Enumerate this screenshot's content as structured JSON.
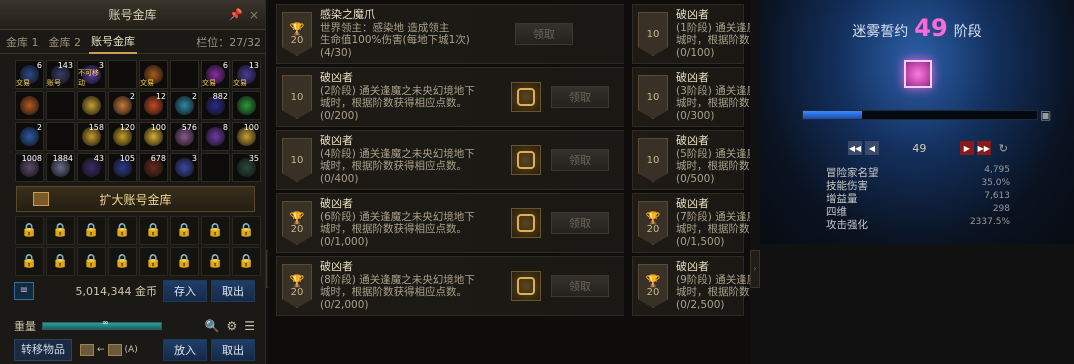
{
  "storage": {
    "title": "账号金库",
    "tabs": [
      "金库 1",
      "金库 2",
      "账号金库"
    ],
    "active_tab": 2,
    "slots_label": "栏位：27/32",
    "items": [
      {
        "color": "#2a4a8a",
        "count": "6",
        "label": "交易"
      },
      {
        "color": "#3a3a6a",
        "count": "143",
        "label": "账号"
      },
      {
        "color": "#5a3aa8",
        "count": "3",
        "label": "不可移动"
      },
      {
        "color": "",
        "count": "",
        "label": ""
      },
      {
        "color": "#a85a1a",
        "count": "",
        "label": "交易"
      },
      {
        "color": "",
        "count": "",
        "label": ""
      },
      {
        "color": "#8a2aa8",
        "count": "6",
        "label": "交易"
      },
      {
        "color": "#4a3a9a",
        "count": "13",
        "label": "交易"
      },
      {
        "color": "#b85a20",
        "count": "",
        "label": ""
      },
      {
        "color": "",
        "count": "",
        "label": ""
      },
      {
        "color": "#c8a030",
        "count": "",
        "label": ""
      },
      {
        "color": "#c87a3a",
        "count": "2",
        "label": ""
      },
      {
        "color": "#c84a20",
        "count": "12",
        "label": ""
      },
      {
        "color": "#2a8aa8",
        "count": "2",
        "label": ""
      },
      {
        "color": "#2a2a8a",
        "count": "882",
        "label": ""
      },
      {
        "color": "#2a9a3a",
        "count": "",
        "label": ""
      },
      {
        "color": "#2a5aa8",
        "count": "2",
        "label": ""
      },
      {
        "color": "",
        "count": "",
        "label": ""
      },
      {
        "color": "#c89a2a",
        "count": "158",
        "label": ""
      },
      {
        "color": "#c8a020",
        "count": "120",
        "label": ""
      },
      {
        "color": "#d8b030",
        "count": "100",
        "label": ""
      },
      {
        "color": "#8a5a8a",
        "count": "576",
        "label": ""
      },
      {
        "color": "#6a3aa8",
        "count": "8",
        "label": ""
      },
      {
        "color": "#c8a030",
        "count": "100",
        "label": ""
      },
      {
        "color": "#5a4a6a",
        "count": "1008",
        "label": ""
      },
      {
        "color": "#6a6a8a",
        "count": "1884",
        "label": ""
      },
      {
        "color": "#3a2a6a",
        "count": "43",
        "label": ""
      },
      {
        "color": "#2a3a8a",
        "count": "105",
        "label": ""
      },
      {
        "color": "#6a2a1a",
        "count": "678",
        "label": ""
      },
      {
        "color": "#3a4aa8",
        "count": "3",
        "label": ""
      },
      {
        "color": "",
        "count": "",
        "label": ""
      },
      {
        "color": "#2a4a3a",
        "count": "35",
        "label": ""
      }
    ],
    "expand_label": "扩大账号金库",
    "gold_amount": "5,014,344 金币",
    "deposit_label": "存入",
    "withdraw_label": "取出",
    "weight_label": "重量",
    "weight_value": "∞",
    "transfer_label": "转移物品",
    "swap_label": "(A)",
    "put_in_label": "放入",
    "take_out_label": "取出"
  },
  "lists": [
    {
      "rows": [
        {
          "badge_type": "cup",
          "badge_num": "20",
          "title": "感染之魔爪",
          "lines": [
            "世界领主：感染地      造成领主",
            "生命值100%伤害(每地下城1次)",
            "(4/30)"
          ],
          "icon": "gold",
          "claim": "领取"
        },
        {
          "badge_type": "num",
          "badge_num": "10",
          "title": "破凶者",
          "lines": [
            "(2阶段) 通关逢魔之未央幻境地下",
            "城时，根据阶数获得相应点数。",
            "(0/200)"
          ],
          "icon": "bronze",
          "claim": "领取"
        },
        {
          "badge_type": "num",
          "badge_num": "10",
          "title": "破凶者",
          "lines": [
            "(4阶段) 通关逢魔之未央幻境地下",
            "城时，根据阶数获得相应点数。",
            "(0/400)"
          ],
          "icon": "bronze",
          "claim": "领取"
        },
        {
          "badge_type": "cup",
          "badge_num": "20",
          "title": "破凶者",
          "lines": [
            "(6阶段) 通关逢魔之未央幻境地下",
            "城时，根据阶数获得相应点数。",
            "(0/1,000)"
          ],
          "icon": "bronze",
          "claim": "领取"
        },
        {
          "badge_type": "cup",
          "badge_num": "20",
          "title": "破凶者",
          "lines": [
            "(8阶段) 通关逢魔之未央幻境地下",
            "城时，根据阶数获得相应点数。",
            "(0/2,000)"
          ],
          "icon": "bronze",
          "claim": "领取"
        }
      ]
    },
    {
      "rows": [
        {
          "badge_type": "num",
          "badge_num": "10",
          "title": "破凶者",
          "lines": [
            "(1阶段) 通关逢魔之未央幻境地下",
            "城时，根据阶数获得相应点数。",
            "(0/100)"
          ],
          "icon": "bronze",
          "claim": "领取"
        },
        {
          "badge_type": "num",
          "badge_num": "10",
          "title": "破凶者",
          "lines": [
            "(3阶段) 通关逢魔之未央幻境地下",
            "城时，根据阶数获得相应点数。",
            "(0/300)"
          ],
          "icon": "bronze",
          "claim": "领取"
        },
        {
          "badge_type": "num",
          "badge_num": "10",
          "title": "破凶者",
          "lines": [
            "(5阶段) 通关逢魔之未央幻境地下",
            "城时，根据阶数获得相应点数。",
            "(0/500)"
          ],
          "icon": "bronze",
          "claim": "领取"
        },
        {
          "badge_type": "cup",
          "badge_num": "20",
          "title": "破凶者",
          "lines": [
            "(7阶段) 通关逢魔之未央幻境地下",
            "城时，根据阶数获得相应点数。",
            "(0/1,500)"
          ],
          "icon": "bronze",
          "claim": "领取"
        },
        {
          "badge_type": "cup",
          "badge_num": "20",
          "title": "破凶者",
          "lines": [
            "(9阶段) 通关逢魔之未央幻境地下",
            "城时，根据阶数获得相应点数。",
            "(0/2,500)"
          ],
          "icon": "bronze",
          "claim": "领取"
        }
      ]
    }
  ],
  "oath": {
    "title_prefix": "迷雾誓约",
    "level": "49",
    "title_suffix": "阶段",
    "progress": 0.25,
    "level_value": "49",
    "stats": [
      {
        "name": "冒险家名望",
        "value": "4,795"
      },
      {
        "name": "技能伤害",
        "value": "35.0%"
      },
      {
        "name": "增益量",
        "value": "7,613"
      },
      {
        "name": "四维",
        "value": "298"
      },
      {
        "name": "攻击强化",
        "value": "2337.5%"
      }
    ]
  }
}
